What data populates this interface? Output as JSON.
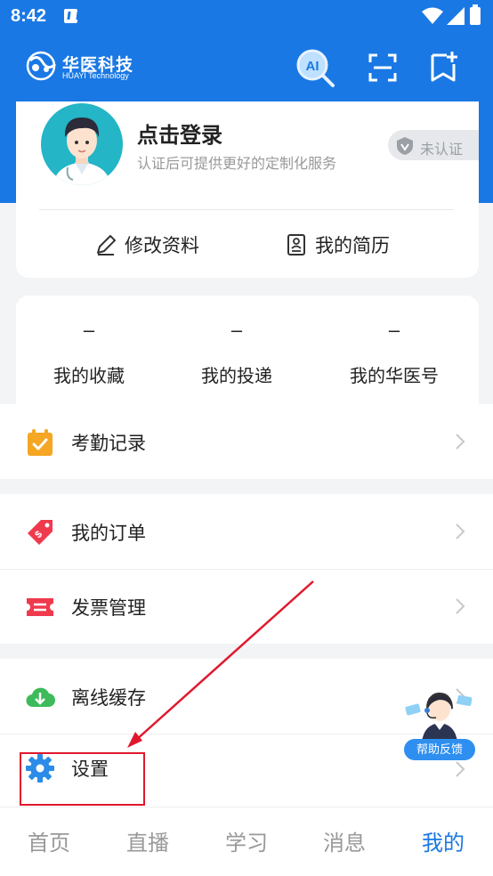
{
  "status_bar": {
    "time": "8:42"
  },
  "header": {
    "logo_cn": "华医科技",
    "logo_en": "HUAYI Technology",
    "ai_label": "AI"
  },
  "profile": {
    "title": "点击登录",
    "subtitle": "认证后可提供更好的定制化服务",
    "verify_badge": "未认证",
    "edit_label": "修改资料",
    "resume_label": "我的简历"
  },
  "stats": [
    {
      "value": "–",
      "label": "我的收藏"
    },
    {
      "value": "–",
      "label": "我的投递"
    },
    {
      "value": "–",
      "label": "我的华医号"
    }
  ],
  "menu": {
    "attendance": "考勤记录",
    "orders": "我的订单",
    "invoice": "发票管理",
    "offline": "离线缓存",
    "settings": "设置"
  },
  "help": {
    "label": "帮助反馈"
  },
  "tabs": [
    {
      "label": "首页"
    },
    {
      "label": "直播"
    },
    {
      "label": "学习"
    },
    {
      "label": "消息"
    },
    {
      "label": "我的"
    }
  ],
  "colors": {
    "brand_blue": "#1a78e4",
    "annotation_red": "#e0182d",
    "icon_orange": "#f5a623",
    "icon_red": "#ef3a4e",
    "icon_green": "#3dbb5a",
    "icon_blue": "#2b8ce8"
  }
}
